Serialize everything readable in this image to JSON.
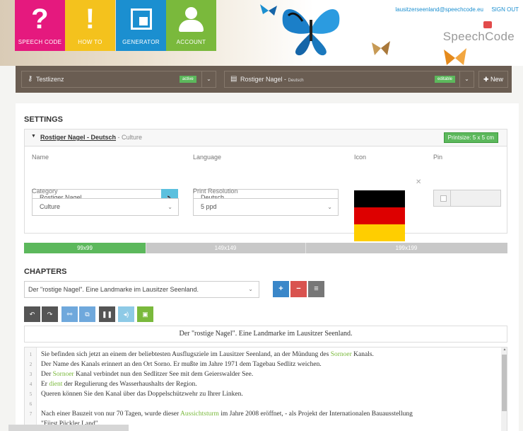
{
  "header": {
    "tiles": [
      {
        "label": "SPEECH CODE",
        "glyph": "?",
        "color": "#e5197e"
      },
      {
        "label": "HOW TO",
        "glyph": "!",
        "color": "#f4c21d"
      },
      {
        "label": "GENERATOR",
        "color": "#1b8fd0"
      },
      {
        "label": "ACCOUNT",
        "color": "#7ab93c"
      }
    ],
    "email": "lausitzerseenland@speechcode.eu",
    "signout": "SIGN OUT",
    "brand": "SpeechCode"
  },
  "license_bar": {
    "license_name": "Testlizenz",
    "license_status": "active",
    "code_name": "Rostiger Nagel",
    "code_lang": "Deutsch",
    "code_status": "editable",
    "new_label": "New"
  },
  "settings": {
    "title": "SETTINGS",
    "box_title_main": "Rostiger Nagel - Deutsch",
    "box_title_sub": "Culture",
    "separator": " - ",
    "printsize": "Printsize: 5 x 5 cm",
    "name_label": "Name",
    "name_value": "Rostiger Nagel",
    "language_label": "Language",
    "language_value": "Deutsch",
    "icon_label": "Icon",
    "pin_label": "Pin",
    "category_label": "Category",
    "category_value": "Culture",
    "print_res_label": "Print Resolution",
    "print_res_value": "5 ppd",
    "flag_colors": [
      "#000000",
      "#dd0000",
      "#ffce00"
    ]
  },
  "resolution_bar": {
    "segments": [
      "99x99",
      "149x149",
      "199x199"
    ],
    "active_index": 0
  },
  "chapters": {
    "title": "CHAPTERS",
    "selected": "Der \"rostige Nagel\". Eine Landmarke im Lausitzer Seenland.",
    "chapter_title": "Der \"rostige Nagel\". Eine Landmarke im Lausitzer Seenland.",
    "lines": [
      {
        "n": "1",
        "segments": [
          {
            "t": "Sie befinden sich jetzt an einem der beliebtesten Ausflugsziele im Lausitzer Seenland, an der Mündung des "
          },
          {
            "t": "Sornoer",
            "hl": true
          },
          {
            "t": " Kanals."
          }
        ]
      },
      {
        "n": "2",
        "segments": [
          {
            "t": "Der Name des Kanals erinnert an den Ort Sorno. Er mußte im Jahre 1971 dem Tagebau Sedlitz weichen."
          }
        ]
      },
      {
        "n": "3",
        "segments": [
          {
            "t": "Der "
          },
          {
            "t": "Sornoer",
            "hl": true
          },
          {
            "t": " Kanal verbindet nun den Sedlitzer See mit dem Geierswalder See."
          }
        ]
      },
      {
        "n": "4",
        "segments": [
          {
            "t": "Er "
          },
          {
            "t": "dient",
            "hl": true
          },
          {
            "t": " der Regulierung des Wasserhaushalts der Region."
          }
        ]
      },
      {
        "n": "5",
        "segments": [
          {
            "t": "Queren können Sie den Kanal über das Doppelschützwehr zu Ihrer Linken."
          }
        ]
      },
      {
        "n": "6",
        "segments": [
          {
            "t": ""
          }
        ]
      },
      {
        "n": "7",
        "segments": [
          {
            "t": "Nach einer Bauzeit von nur 70 Tagen, wurde dieser "
          },
          {
            "t": "Aussichtsturm",
            "hl": true
          },
          {
            "t": " im Jahre 2008 eröffnet, - als Projekt der Internationalen Bauausstellung"
          }
        ]
      },
      {
        "n": "",
        "segments": [
          {
            "t": "\"Fürst Pückler Land\"."
          }
        ]
      }
    ]
  },
  "icons": {
    "license": "key-icon",
    "document": "document-icon",
    "speak": "speaker-icon",
    "close": "close-icon"
  }
}
